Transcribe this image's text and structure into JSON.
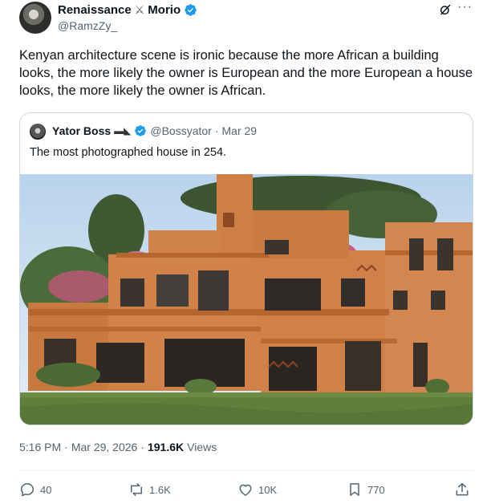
{
  "author": {
    "display_name_part1": "Renaissance",
    "display_name_separator_icon": "crossed-swords-icon",
    "display_name_part2": "Morio",
    "handle": "@RamzZy_",
    "verified": true
  },
  "tweet": {
    "text": "Kenyan architecture scene is ironic because the more African a building looks, the more likely the owner is European and the more European a house looks, the more likely the owner is African."
  },
  "quoted": {
    "display_name": "Yator Boss",
    "name_icon": "gun-icon",
    "handle": "@Bossyator",
    "separator": "·",
    "date": "Mar 29",
    "text": "The most photographed house in 254."
  },
  "meta": {
    "time": "5:16 PM",
    "separator1": "·",
    "date": "Mar 29, 2026",
    "separator2": "·",
    "views_count": "191.6K",
    "views_label": "Views"
  },
  "actions": {
    "replies": "40",
    "reposts": "1.6K",
    "likes": "10K",
    "bookmarks": "770"
  },
  "colors": {
    "verified_blue": "#1d9bf0",
    "secondary_text": "#536471",
    "border": "#cfd9de"
  }
}
